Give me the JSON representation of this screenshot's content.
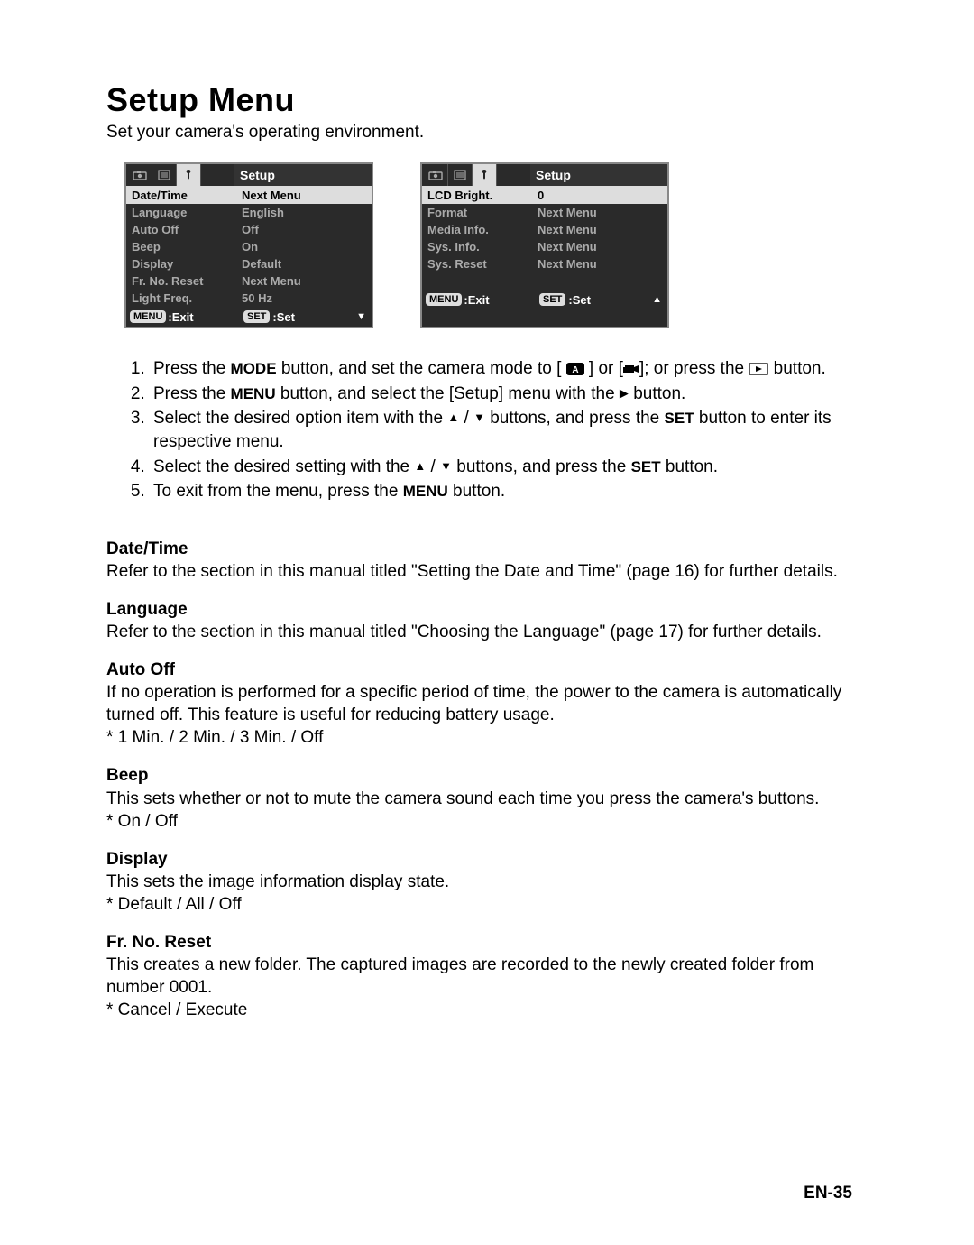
{
  "title": "Setup Menu",
  "subtitle": "Set your camera's operating environment.",
  "screens": {
    "header_label": "Setup",
    "bottom_menu": "MENU",
    "bottom_exit": ":Exit",
    "bottom_set_badge": "SET",
    "bottom_set": ":Set",
    "left": {
      "selected": {
        "label": "Date/Time",
        "value": "Next Menu"
      },
      "rows": [
        {
          "label": "Language",
          "value": "English"
        },
        {
          "label": "Auto Off",
          "value": "Off"
        },
        {
          "label": "Beep",
          "value": "On"
        },
        {
          "label": "Display",
          "value": "Default"
        },
        {
          "label": "Fr. No. Reset",
          "value": "Next Menu"
        },
        {
          "label": "Light Freq.",
          "value": "50 Hz"
        }
      ],
      "arrow": "down"
    },
    "right": {
      "selected": {
        "label": "LCD Bright.",
        "value": "0"
      },
      "rows": [
        {
          "label": "Format",
          "value": "Next Menu"
        },
        {
          "label": "Media Info.",
          "value": "Next Menu"
        },
        {
          "label": "Sys. Info.",
          "value": "Next Menu"
        },
        {
          "label": "Sys. Reset",
          "value": "Next Menu"
        },
        {
          "label": "",
          "value": ""
        }
      ],
      "arrow": "up"
    }
  },
  "steps": {
    "s1a": "Press the ",
    "s1_mode": "MODE",
    "s1b": " button, and set the camera mode to [ ",
    "s1c": " ] or [",
    "s1d": "]; or press the ",
    "s1e": " button.",
    "s2a": "Press the ",
    "s2_menu": "MENU",
    "s2b": " button, and select the [Setup] menu with the ",
    "s2c": " button.",
    "s3a": "Select the desired option item with the ",
    "s3b": " buttons, and press the ",
    "s3_set": "SET",
    "s3c": " button to enter its respective menu.",
    "s4a": "Select the desired setting with the ",
    "s4b": " buttons, and press the ",
    "s4c": " button.",
    "s5a": "To exit from the menu, press the ",
    "s5b": " button."
  },
  "sections": [
    {
      "title": "Date/Time",
      "body": "Refer to the section in this manual titled \"Setting the Date and Time\" (page 16) for further details."
    },
    {
      "title": "Language",
      "body": "Refer to the section in this manual titled \"Choosing the Language\" (page 17) for further details."
    },
    {
      "title": "Auto Off",
      "body": "If no operation is performed for a specific period of time, the power to the camera is automatically turned off. This feature is useful for reducing battery usage.",
      "opts": "* 1 Min. / 2 Min. / 3 Min. / Off"
    },
    {
      "title": "Beep",
      "body": "This sets whether or not to mute the camera sound each time you press the camera's buttons.",
      "opts": "* On / Off"
    },
    {
      "title": "Display",
      "body": "This sets the image information display state.",
      "opts": "* Default / All / Off"
    },
    {
      "title": "Fr. No. Reset",
      "body": "This creates a new folder. The captured images are recorded to the newly created folder from number 0001.",
      "opts": "* Cancel / Execute"
    }
  ],
  "page_number": "EN-35"
}
